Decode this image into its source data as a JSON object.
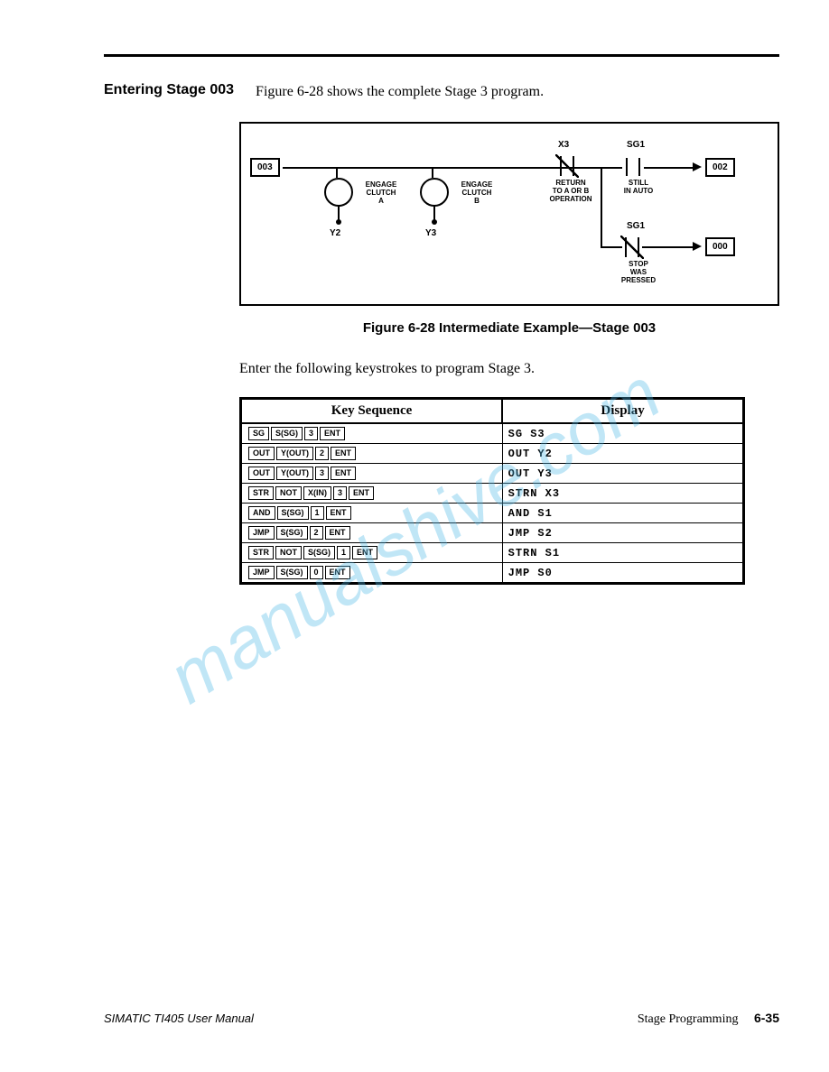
{
  "section_title": "Entering Stage 003",
  "intro_text": "Figure 6-28 shows the complete Stage 3 program.",
  "diagram": {
    "left_box": "003",
    "out_top": "002",
    "out_bot": "000",
    "coil_a_label": "ENGAGE\nCLUTCH\nA",
    "coil_a_out": "Y2",
    "coil_b_label": "ENGAGE\nCLUTCH\nB",
    "coil_b_out": "Y3",
    "x3": "X3",
    "x3_label": "RETURN\nTO A OR B\nOPERATION",
    "sg1_top": "SG1",
    "sg1_top_label": "STILL\nIN AUTO",
    "sg1_bot": "SG1",
    "sg1_bot_label": "STOP\nWAS\nPRESSED"
  },
  "figure_caption": "Figure 6-28    Intermediate Example—Stage 003",
  "enter_text": "Enter the following keystrokes to program Stage 3.",
  "table": {
    "head_keys": "Key Sequence",
    "head_disp": "Display",
    "rows": [
      {
        "keys": [
          "SG",
          "S(SG)",
          "3",
          "ENT"
        ],
        "display": "SG S3"
      },
      {
        "keys": [
          "OUT",
          "Y(OUT)",
          "2",
          "ENT"
        ],
        "display": "OUT Y2"
      },
      {
        "keys": [
          "OUT",
          "Y(OUT)",
          "3",
          "ENT"
        ],
        "display": "OUT Y3"
      },
      {
        "keys": [
          "STR",
          "NOT",
          "X(IN)",
          "3",
          "ENT"
        ],
        "display": "STRN X3"
      },
      {
        "keys": [
          "AND",
          "S(SG)",
          "1",
          "ENT"
        ],
        "display": "AND S1"
      },
      {
        "keys": [
          "JMP",
          "S(SG)",
          "2",
          "ENT"
        ],
        "display": "JMP S2"
      },
      {
        "keys": [
          "STR",
          "NOT",
          "S(SG)",
          "1",
          "ENT"
        ],
        "display": "STRN S1"
      },
      {
        "keys": [
          "JMP",
          "S(SG)",
          "0",
          "ENT"
        ],
        "display": "JMP S0"
      }
    ]
  },
  "watermark": "manualshive.com",
  "footer": {
    "left": "SIMATIC TI405 User Manual",
    "right_text": "Stage Programming",
    "page_no": "6-35"
  }
}
